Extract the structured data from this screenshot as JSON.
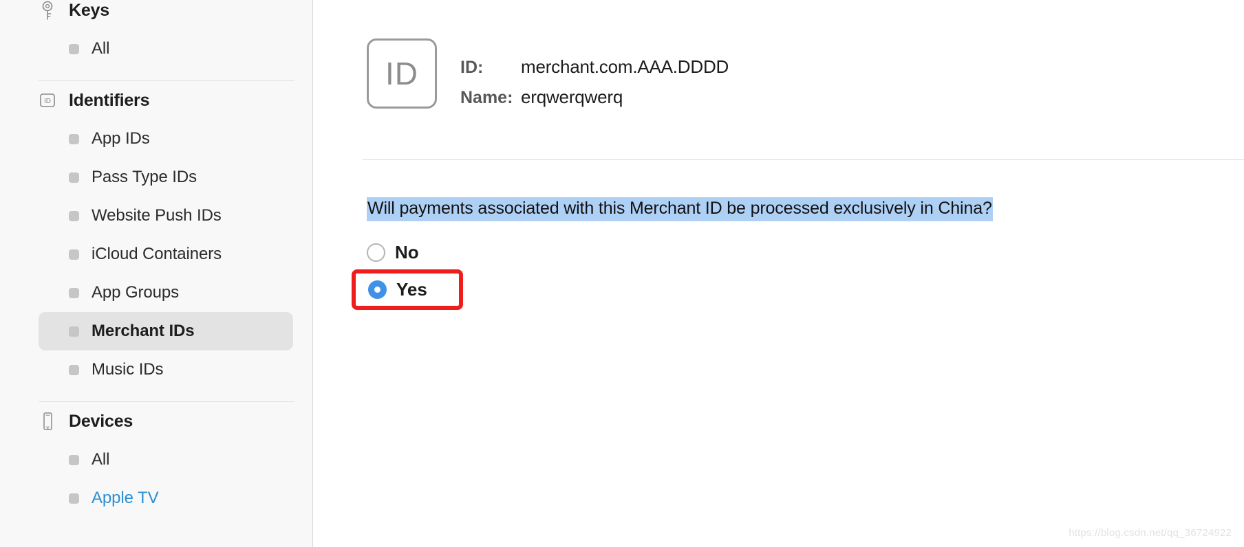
{
  "sidebar": {
    "groups": [
      {
        "label": "Keys",
        "icon": "key-icon",
        "items": [
          {
            "label": "All",
            "selected": false,
            "link": false
          }
        ]
      },
      {
        "label": "Identifiers",
        "icon": "identifier-badge-icon",
        "items": [
          {
            "label": "App IDs",
            "selected": false,
            "link": false
          },
          {
            "label": "Pass Type IDs",
            "selected": false,
            "link": false
          },
          {
            "label": "Website Push IDs",
            "selected": false,
            "link": false
          },
          {
            "label": "iCloud Containers",
            "selected": false,
            "link": false
          },
          {
            "label": "App Groups",
            "selected": false,
            "link": false
          },
          {
            "label": "Merchant IDs",
            "selected": true,
            "link": false
          },
          {
            "label": "Music IDs",
            "selected": false,
            "link": false
          }
        ]
      },
      {
        "label": "Devices",
        "icon": "device-phone-icon",
        "items": [
          {
            "label": "All",
            "selected": false,
            "link": false
          },
          {
            "label": "Apple TV",
            "selected": false,
            "link": true
          }
        ]
      }
    ]
  },
  "main": {
    "badge_text": "ID",
    "fields": [
      {
        "key": "ID:",
        "value": "merchant.com.AAA.DDDD"
      },
      {
        "key": "Name:",
        "value": "erqwerqwerq"
      }
    ],
    "question": "Will payments associated with this Merchant ID be processed exclusively in China?",
    "options": [
      {
        "label": "No",
        "checked": false,
        "annotated": false
      },
      {
        "label": "Yes",
        "checked": true,
        "annotated": true
      }
    ]
  },
  "watermark": "https://blog.csdn.net/qq_36724922",
  "colors": {
    "selection_highlight": "#aed0f5",
    "annotation_red": "#f01d1d",
    "radio_blue": "#3f92e8",
    "link_blue": "#2b8fd4"
  }
}
